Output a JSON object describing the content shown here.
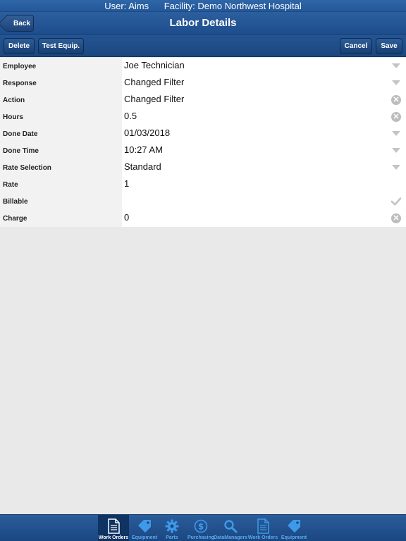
{
  "header": {
    "user": "User: Aims",
    "facility": "Facility: Demo Northwest Hospital",
    "title": "Labor Details",
    "back_label": "Back"
  },
  "toolbar": {
    "delete_label": "Delete",
    "test_equip_label": "Test Equip.",
    "cancel_label": "Cancel",
    "save_label": "Save"
  },
  "fields": [
    {
      "label": "Employee",
      "value": "Joe Technician",
      "icon": "dropdown-arrow-icon"
    },
    {
      "label": "Response",
      "value": "Changed Filter",
      "icon": "dropdown-arrow-icon"
    },
    {
      "label": "Action",
      "value": "Changed Filter",
      "icon": "clear-icon"
    },
    {
      "label": "Hours",
      "value": "0.5",
      "icon": "clear-icon"
    },
    {
      "label": "Done Date",
      "value": "01/03/2018",
      "icon": "dropdown-arrow-icon"
    },
    {
      "label": "Done Time",
      "value": "10:27 AM",
      "icon": "dropdown-arrow-icon"
    },
    {
      "label": "Rate Selection",
      "value": "Standard",
      "icon": "dropdown-arrow-icon"
    },
    {
      "label": "Rate",
      "value": "1",
      "icon": ""
    },
    {
      "label": "Billable",
      "value": "",
      "icon": "checkmark-icon"
    },
    {
      "label": "Charge",
      "value": "0",
      "icon": "clear-icon"
    }
  ],
  "tabs": [
    {
      "label": "Work Orders",
      "icon": "document-icon",
      "active": true
    },
    {
      "label": "Equipment",
      "icon": "tag-icon",
      "active": false
    },
    {
      "label": "Parts",
      "icon": "gear-icon",
      "active": false
    },
    {
      "label": "Purchasing",
      "icon": "dollar-icon",
      "active": false
    },
    {
      "label": "DataManagers",
      "icon": "search-icon",
      "active": false
    },
    {
      "label": "Work Orders",
      "icon": "document-icon",
      "active": false
    },
    {
      "label": "Equipment",
      "icon": "tag-icon",
      "active": false
    }
  ],
  "colors": {
    "bar_blue": "#23589a",
    "tab_label_blue": "#5aa9ef",
    "icon_gray": "#bdbdbd"
  }
}
